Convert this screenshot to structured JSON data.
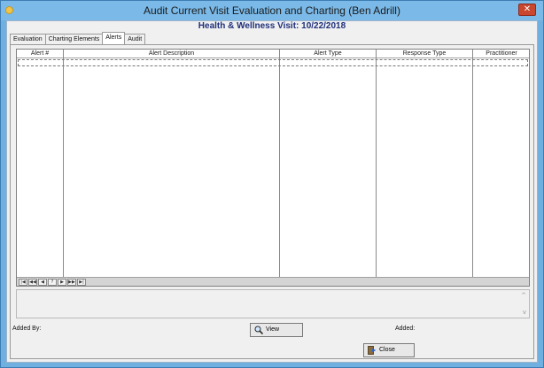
{
  "window": {
    "title": "Audit Current Visit Evaluation and Charting (Ben Adrill)",
    "close_glyph": "✕"
  },
  "heading": "Health & Wellness Visit: 10/22/2018",
  "tabs": [
    {
      "label": "Evaluation"
    },
    {
      "label": "Charting Elements"
    },
    {
      "label": "Alerts"
    },
    {
      "label": "Audit"
    }
  ],
  "active_tab": "Alerts",
  "grid": {
    "columns": [
      "Alert #",
      "Alert Description",
      "Alert Type",
      "Response Type",
      "Practitioner"
    ],
    "rows": []
  },
  "navigator": {
    "buttons": [
      "|◀",
      "◀◀",
      "◀",
      "?",
      "▶",
      "▶▶",
      "▶|"
    ]
  },
  "footer": {
    "added_by_label": "Added By:",
    "view_button": "View",
    "added_label": "Added:",
    "close_button": "Close"
  },
  "icons": {
    "title": "app-icon",
    "view": "magnifier-icon",
    "close": "exit-door-icon"
  }
}
